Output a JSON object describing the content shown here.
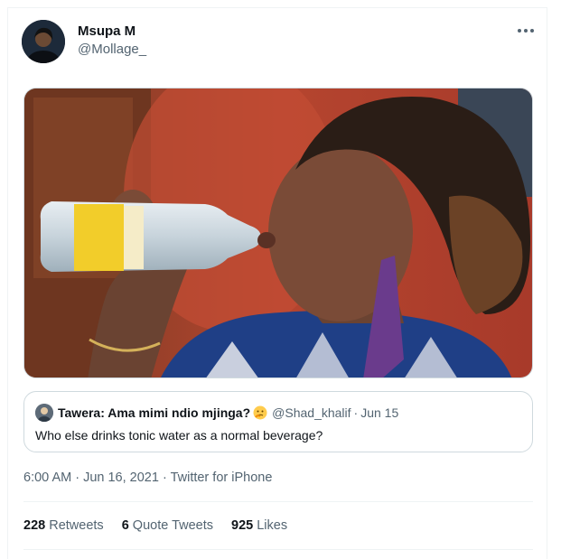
{
  "tweet": {
    "author_name": "Msupa M",
    "author_handle": "@Mollage_",
    "more_icon": "ellipsis-icon",
    "photo_alt_icon": "tweet-photo",
    "timestamp": "6:00 AM · Jun 16, 2021",
    "source_sep": " · ",
    "source": "Twitter for iPhone"
  },
  "quote": {
    "author_name": "Tawera: Ama mimi ndio mjinga?",
    "emoji": "thinking-face-emoji",
    "author_handle": "@Shad_khalif",
    "separator": "·",
    "date": "Jun 15",
    "text": "Who else drinks tonic water as a normal beverage?"
  },
  "stats": {
    "retweets_count": "228",
    "retweets_label": "Retweets",
    "quotes_count": "6",
    "quotes_label": "Quote Tweets",
    "likes_count": "925",
    "likes_label": "Likes"
  },
  "colors": {
    "text_primary": "#0f1419",
    "text_secondary": "#536471",
    "border": "#cfd9de",
    "divider": "#eff3f4"
  }
}
